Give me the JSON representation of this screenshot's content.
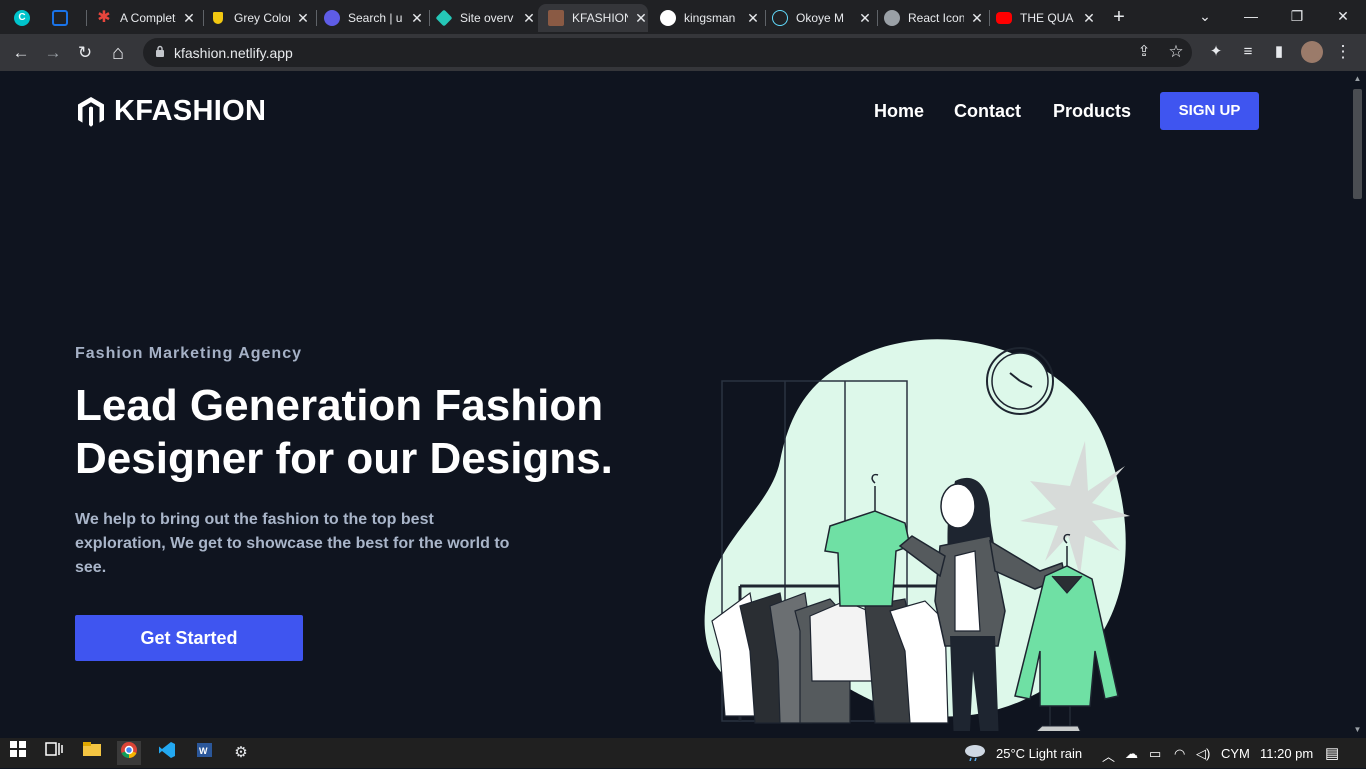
{
  "browser": {
    "tabs": [
      {
        "label": "",
        "icon": "canva-icon",
        "color": "#00c4cc",
        "active": false
      },
      {
        "label": "",
        "icon": "ms-icon",
        "color": "#1a73e8",
        "active": false
      },
      {
        "label": "A Complete",
        "icon": "asterisk-icon",
        "color": "#e8453c",
        "active": false
      },
      {
        "label": "Grey Color",
        "icon": "shield-icon",
        "color": "#f2c811",
        "active": false
      },
      {
        "label": "Search | u",
        "icon": "search-logo-icon",
        "color": "#5e5ce6",
        "active": false
      },
      {
        "label": "Site overv",
        "icon": "netlify-icon",
        "color": "#25c7b7",
        "active": false
      },
      {
        "label": "KFASHION",
        "icon": "kfashion-icon",
        "color": "#8a5a44",
        "active": true
      },
      {
        "label": "kingsman",
        "icon": "github-icon",
        "color": "#ffffff",
        "active": false
      },
      {
        "label": "Okoye M",
        "icon": "react-icon",
        "color": "#61dafb",
        "active": false
      },
      {
        "label": "React Icon",
        "icon": "globe-icon",
        "color": "#9aa0a6",
        "active": false
      },
      {
        "label": "THE QUA",
        "icon": "youtube-icon",
        "color": "#ff0000",
        "active": false
      }
    ],
    "new_tab": "+",
    "controls": {
      "dropdown": "⌄",
      "minimize": "—",
      "restore": "❐",
      "close": "✕"
    },
    "nav": {
      "back": "←",
      "forward": "→",
      "reload": "↻",
      "home": "⌂"
    },
    "url": "kfashion.netlify.app",
    "toolbar_icons": {
      "share": "⇪",
      "star": "☆",
      "extensions": "✦",
      "media": "≡",
      "sidepanel": "▮",
      "menu": "⋮"
    }
  },
  "site": {
    "brand": "KFASHION",
    "nav": {
      "home": "Home",
      "contact": "Contact",
      "products": "Products",
      "signup": "SIGN UP"
    },
    "hero": {
      "eyebrow": "Fashion Marketing Agency",
      "headline_line1": "Lead Generation Fashion",
      "headline_line2": "Designer for our Designs.",
      "description": "We help to bring out the fashion to the top best exploration, We get to showcase the best for the world to see.",
      "cta": "Get Started"
    },
    "colors": {
      "background": "#0f141f",
      "accent": "#3f55f0",
      "blob": "#ddf8ea",
      "garment": "#6fe0a4"
    }
  },
  "taskbar": {
    "weather": "25°C  Light rain",
    "language": "CYM",
    "time": "11:20 pm",
    "apps": [
      "windows-icon",
      "task-view-icon",
      "file-explorer-icon",
      "chrome-icon",
      "vscode-icon",
      "word-icon",
      "settings-icon"
    ]
  }
}
